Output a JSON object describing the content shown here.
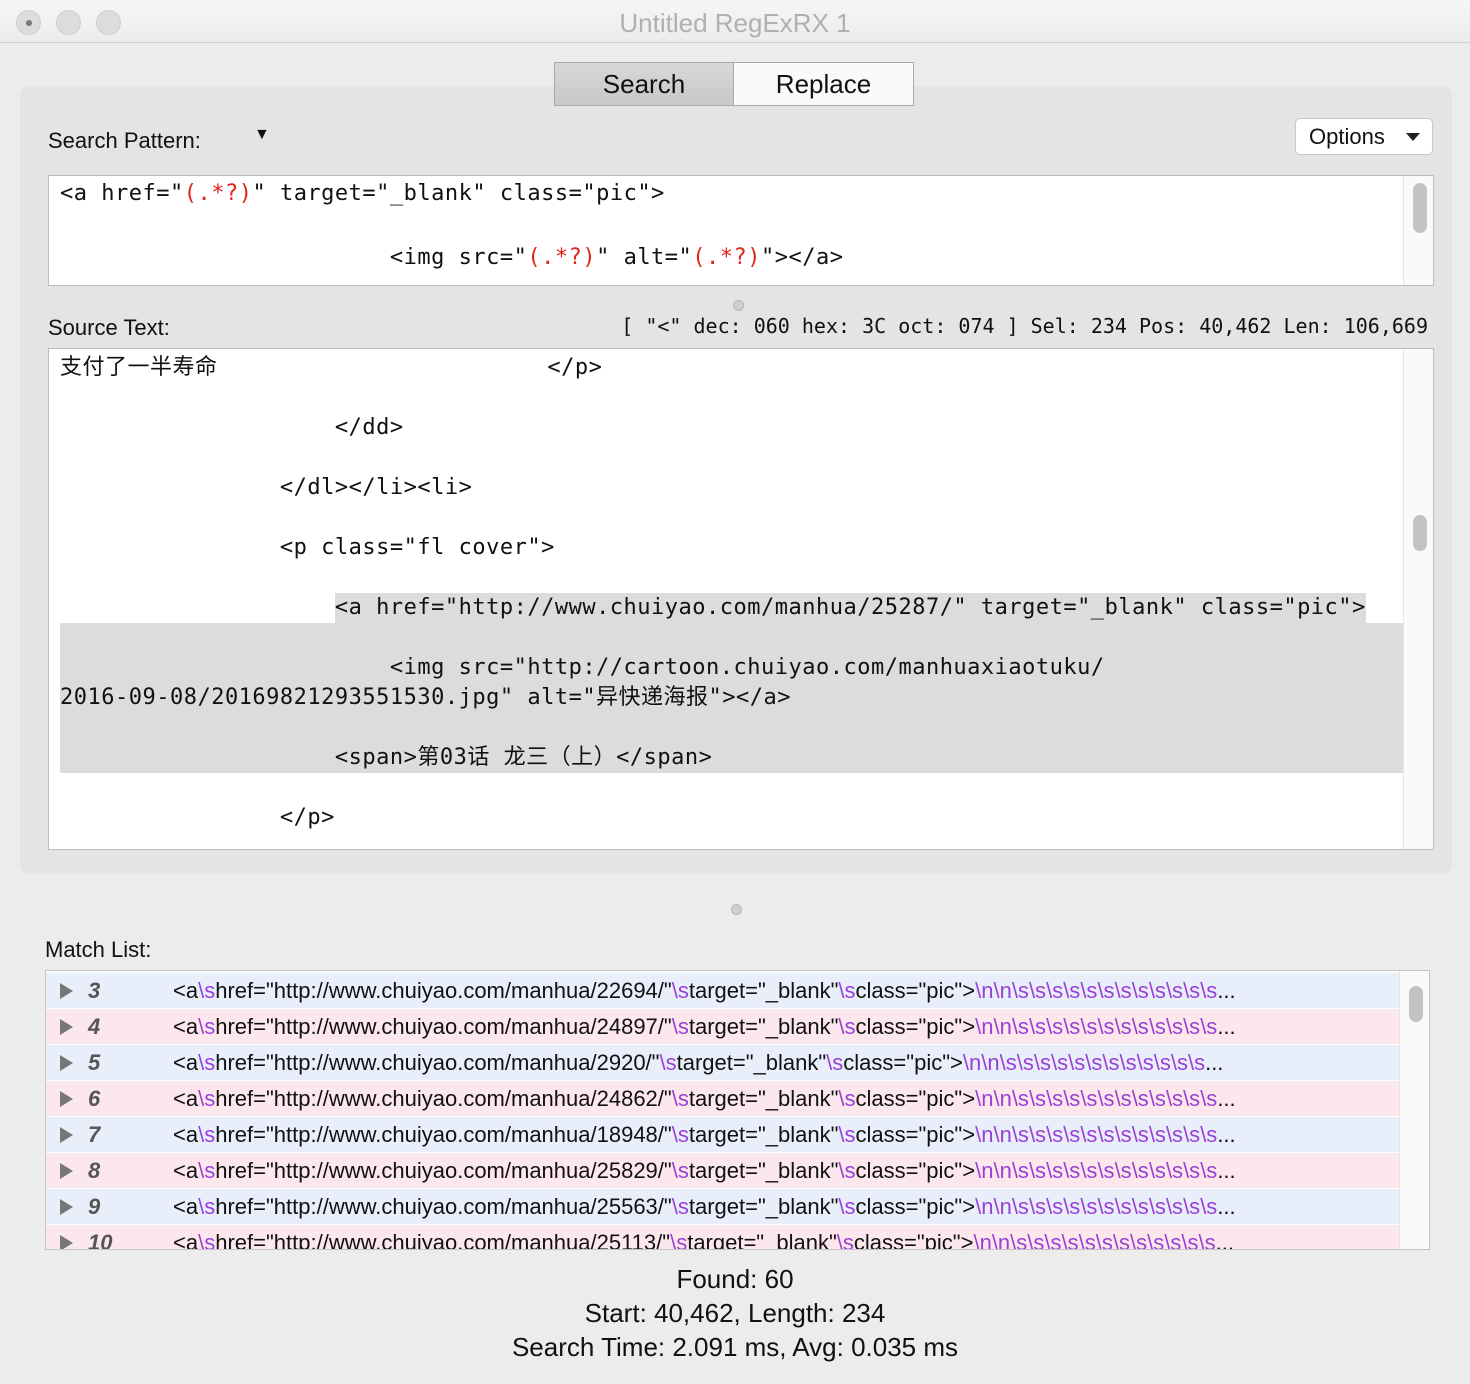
{
  "window": {
    "title": "Untitled RegExRX 1"
  },
  "tabs": [
    {
      "label": "Search",
      "active": true
    },
    {
      "label": "Replace",
      "active": false
    }
  ],
  "search_pattern": {
    "label": "Search Pattern:",
    "options_label": "Options",
    "lines": [
      "<a href=\"(.*?)\" target=\"_blank\" class=\"pic\">",
      "",
      "                        <img src=\"(.*?)\" alt=\"(.*?)\"></a>"
    ],
    "group_token": "(.*?)",
    "group_color": "#e0241b"
  },
  "source_text": {
    "label": "Source Text:",
    "status": "[ \"<\" dec: 060 hex: 3C oct: 074 ] Sel: 234 Pos: 40,462 Len: 106,669",
    "lines": [
      {
        "text": "支付了一半寿命                        </p>",
        "sel": "none"
      },
      {
        "text": "",
        "sel": "none"
      },
      {
        "text": "                    </dd>",
        "sel": "none"
      },
      {
        "text": "",
        "sel": "none"
      },
      {
        "text": "                </dl></li><li>",
        "sel": "none"
      },
      {
        "text": "",
        "sel": "none"
      },
      {
        "text": "                <p class=\"fl cover\">",
        "sel": "none"
      },
      {
        "text": "",
        "sel": "none"
      },
      {
        "text": "                    <a href=\"http://www.chuiyao.com/manhua/25287/\" target=\"_blank\" class=\"pic\">",
        "sel": "partial"
      },
      {
        "text": "",
        "sel": "full"
      },
      {
        "text": "                        <img src=\"http://cartoon.chuiyao.com/manhuaxiaotuku/",
        "sel": "full"
      },
      {
        "text": "2016-09-08/20169821293551530.jpg\" alt=\"异快递海报\"></a>",
        "sel": "full"
      },
      {
        "text": "",
        "sel": "full"
      },
      {
        "text": "                    <span>第03话 龙三（上）</span>",
        "sel": "full"
      },
      {
        "text": "",
        "sel": "none"
      },
      {
        "text": "                </p>",
        "sel": "none"
      }
    ]
  },
  "match_list": {
    "label": "Match List:",
    "escape_color": "#9b3fd6",
    "rows": [
      {
        "num": "3",
        "text": "<a\\shref=\"http://www.chuiyao.com/manhua/22694/\"\\starget=\"_blank\"\\sclass=\"pic\">\\n\\n\\s\\s\\s\\s\\s\\s\\s\\s\\s\\s\\s\\s..."
      },
      {
        "num": "4",
        "text": "<a\\shref=\"http://www.chuiyao.com/manhua/24897/\"\\starget=\"_blank\"\\sclass=\"pic\">\\n\\n\\s\\s\\s\\s\\s\\s\\s\\s\\s\\s\\s\\s..."
      },
      {
        "num": "5",
        "text": "<a\\shref=\"http://www.chuiyao.com/manhua/2920/\"\\starget=\"_blank\"\\sclass=\"pic\">\\n\\n\\s\\s\\s\\s\\s\\s\\s\\s\\s\\s\\s\\s..."
      },
      {
        "num": "6",
        "text": "<a\\shref=\"http://www.chuiyao.com/manhua/24862/\"\\starget=\"_blank\"\\sclass=\"pic\">\\n\\n\\s\\s\\s\\s\\s\\s\\s\\s\\s\\s\\s\\s..."
      },
      {
        "num": "7",
        "text": "<a\\shref=\"http://www.chuiyao.com/manhua/18948/\"\\starget=\"_blank\"\\sclass=\"pic\">\\n\\n\\s\\s\\s\\s\\s\\s\\s\\s\\s\\s\\s\\s..."
      },
      {
        "num": "8",
        "text": "<a\\shref=\"http://www.chuiyao.com/manhua/25829/\"\\starget=\"_blank\"\\sclass=\"pic\">\\n\\n\\s\\s\\s\\s\\s\\s\\s\\s\\s\\s\\s\\s..."
      },
      {
        "num": "9",
        "text": "<a\\shref=\"http://www.chuiyao.com/manhua/25563/\"\\starget=\"_blank\"\\sclass=\"pic\">\\n\\n\\s\\s\\s\\s\\s\\s\\s\\s\\s\\s\\s\\s..."
      },
      {
        "num": "10",
        "text": "<a\\shref=\"http://www.chuiyao.com/manhua/25113/\"\\starget=\"_blank\"\\sclass=\"pic\">\\n\\n\\s\\s\\s\\s\\s\\s\\s\\s\\s\\s\\s\\s..."
      }
    ]
  },
  "footer": {
    "found": "Found: 60",
    "start_length": "Start: 40,462, Length: 234",
    "search_time": "Search Time: 2.091 ms, Avg: 0.035 ms"
  }
}
